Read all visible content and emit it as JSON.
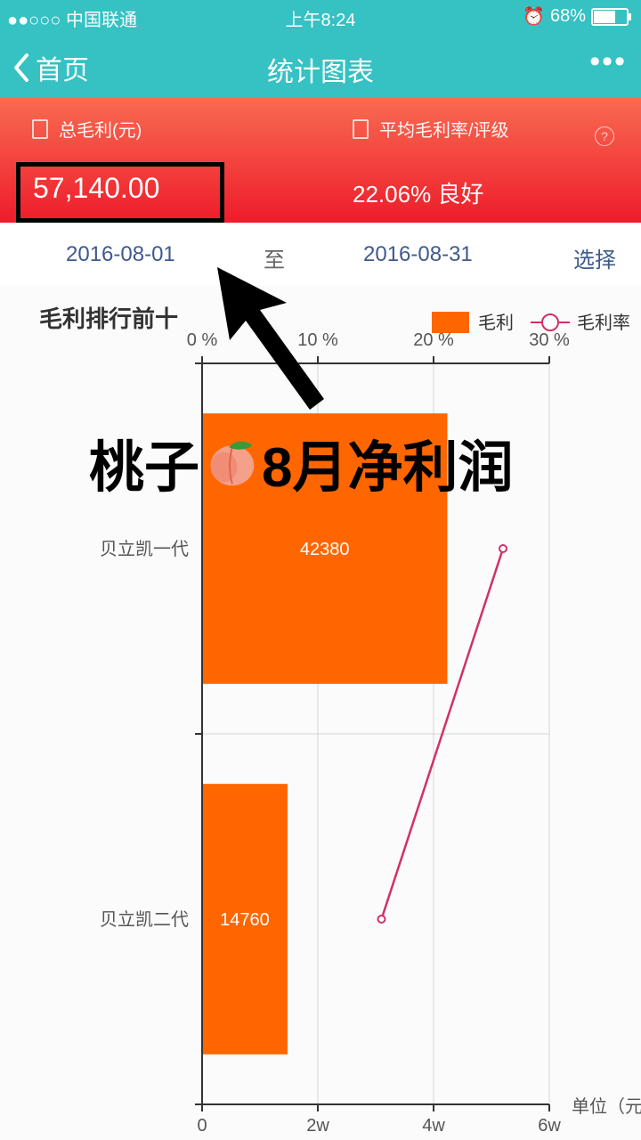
{
  "status_bar": {
    "carrier": "●●○○○ 中国联通",
    "time": "上午8:24",
    "battery_text": "68%"
  },
  "nav": {
    "back_label": "首页",
    "title": "统计图表",
    "more": "•••"
  },
  "summary": {
    "total_label": "总毛利(元)",
    "total_value": "57,140.00",
    "avg_label": "平均毛利率/评级",
    "avg_value": "22.06% 良好",
    "help": "?"
  },
  "date_range": {
    "start": "2016-08-01",
    "to": "至",
    "end": "2016-08-31",
    "select": "选择"
  },
  "overlay_text": {
    "left": "桃子",
    "right": "8月净利润"
  },
  "chart_data": {
    "type": "bar",
    "title": "毛利排行前十",
    "categories": [
      "贝立凯一代",
      "贝立凯二代"
    ],
    "series": [
      {
        "name": "毛利",
        "type": "bar",
        "values": [
          42380,
          14760
        ],
        "color": "#ff6600"
      },
      {
        "name": "毛利率",
        "type": "line",
        "values": [
          26,
          15.5
        ],
        "color": "#d0306a"
      }
    ],
    "x_bottom_ticks": [
      "0",
      "2w",
      "4w",
      "6w"
    ],
    "x_bottom_range": [
      0,
      60000
    ],
    "x_top_ticks": [
      "0 %",
      "10 %",
      "20 %",
      "30 %"
    ],
    "x_top_range": [
      0,
      30
    ],
    "unit_label": "单位（元",
    "legend_position": "top-right",
    "grid": true
  },
  "colors": {
    "teal": "#36c1c3",
    "red": "#ee1c2a",
    "bar": "#ff6600",
    "line": "#d0306a",
    "date_text": "#3f5a8c"
  }
}
